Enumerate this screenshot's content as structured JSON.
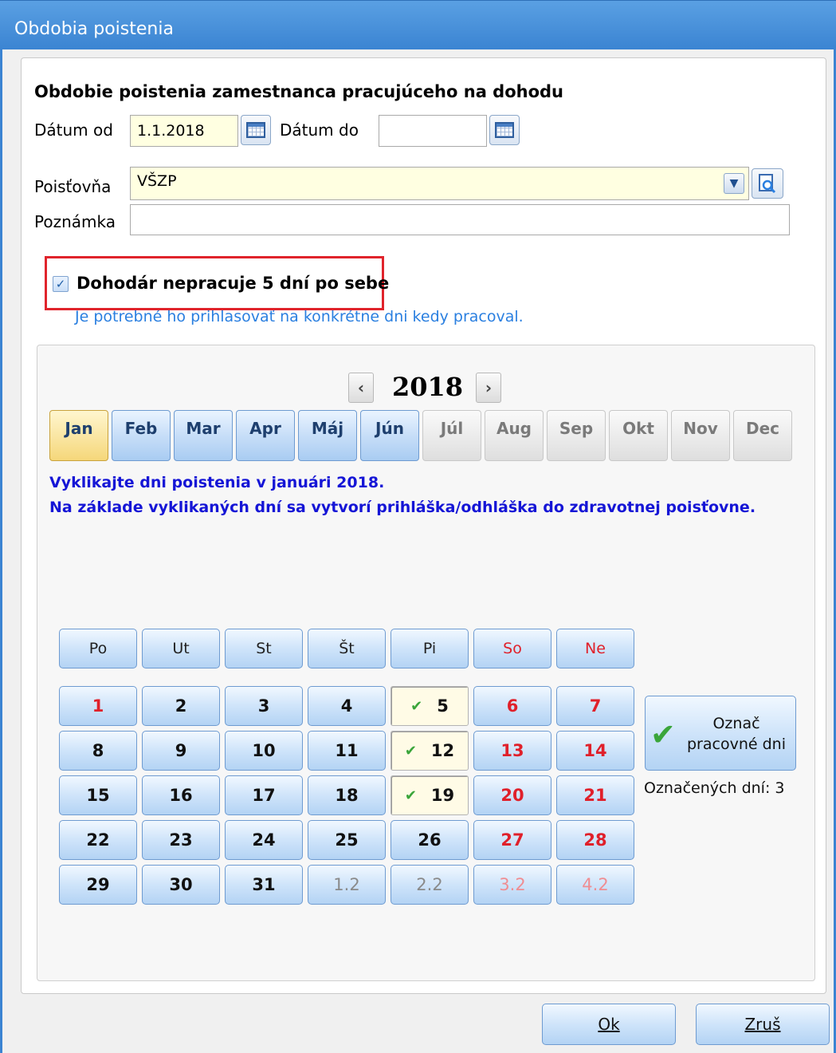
{
  "window": {
    "title": "Obdobia poistenia"
  },
  "form": {
    "heading": "Obdobie poistenia zamestnanca pracujúceho na dohodu",
    "date_from_label": "Dátum od",
    "date_from_value": "1.1.2018",
    "date_to_label": "Dátum do",
    "date_to_value": "",
    "insurer_label": "Poisťovňa",
    "insurer_value": "VŠZP",
    "note_label": "Poznámka",
    "note_value": ""
  },
  "option": {
    "checked": true,
    "label": "Dohodár nepracuje 5 dní po sebe",
    "hint": "Je potrebné ho prihlasovať na konkrétne dni kedy pracoval."
  },
  "calendar": {
    "year": "2018",
    "months": [
      "Jan",
      "Feb",
      "Mar",
      "Apr",
      "Máj",
      "Jún",
      "Júl",
      "Aug",
      "Sep",
      "Okt",
      "Nov",
      "Dec"
    ],
    "selected_month": "Jan",
    "info_line1": "Vyklikajte dni poistenia v januári 2018.",
    "info_line2": "Na základe vyklikaných dní sa vytvorí prihláška/odhláška do zdravotnej poisťovne.",
    "weekdays": [
      "Po",
      "Ut",
      "St",
      "Št",
      "Pi",
      "So",
      "Ne"
    ],
    "weeks": [
      [
        "1",
        "2",
        "3",
        "4",
        "5",
        "6",
        "7"
      ],
      [
        "8",
        "9",
        "10",
        "11",
        "12",
        "13",
        "14"
      ],
      [
        "15",
        "16",
        "17",
        "18",
        "19",
        "20",
        "21"
      ],
      [
        "22",
        "23",
        "24",
        "25",
        "26",
        "27",
        "28"
      ],
      [
        "29",
        "30",
        "31",
        "1.2",
        "2.2",
        "3.2",
        "4.2"
      ]
    ],
    "checked_days": [
      "5",
      "12",
      "19"
    ],
    "mark_button": "Označ pracovné dni",
    "marked_count": "Označených dní: 3"
  },
  "buttons": {
    "ok": "Ok",
    "cancel": "Zruš"
  },
  "colors": {
    "title_bar": "#3b84d2",
    "weekend": "#e0202a",
    "info": "#1515d6",
    "hint": "#2a7fe0",
    "highlight_box": "#e0242c"
  }
}
